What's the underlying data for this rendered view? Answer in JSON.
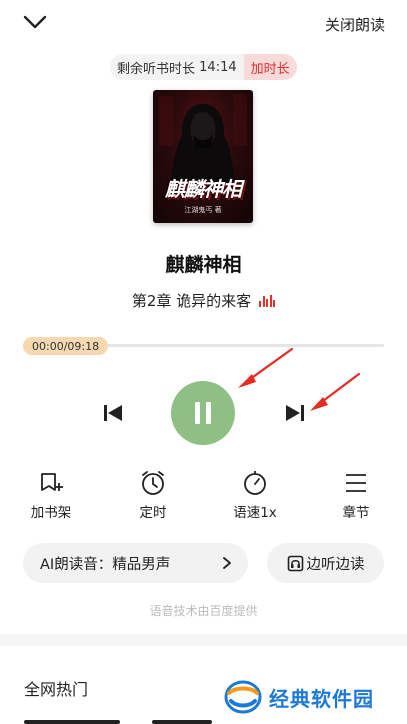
{
  "header": {
    "close_label": "关闭朗读"
  },
  "timer": {
    "remaining_label": "剩余听书时长",
    "remaining_time": "14:14",
    "add_label": "加时长"
  },
  "book": {
    "cover_title": "麒麟神相",
    "cover_author": "江湖鬼丐 著",
    "title": "麒麟神相",
    "chapter": "第2章 诡异的来客"
  },
  "player": {
    "time_display": "00:00/09:18",
    "progress": 0.0,
    "state": "playing"
  },
  "actions": [
    {
      "label": "加书架",
      "icon": "add-bookshelf-icon"
    },
    {
      "label": "定时",
      "icon": "alarm-clock-icon"
    },
    {
      "label": "语速1x",
      "icon": "speed-gauge-icon"
    },
    {
      "label": "章节",
      "icon": "menu-list-icon"
    }
  ],
  "voice": {
    "label": "AI朗读音：精品男声",
    "listen_read_label": "边听边读"
  },
  "footer": {
    "provider_note": "语音技术由百度提供",
    "hot_heading": "全网热门",
    "watermark": "经典软件园"
  },
  "colors": {
    "accent_red": "#e2312d",
    "play_green": "#8fbf85",
    "time_pill": "#f6d9b0",
    "watermark_blue": "#1c79d6"
  }
}
